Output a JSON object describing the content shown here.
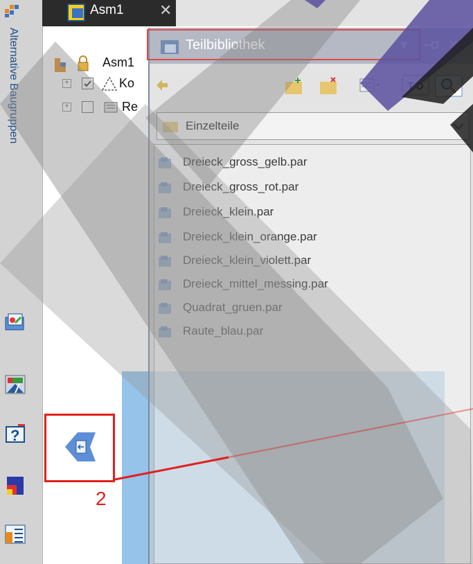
{
  "document_tab": {
    "label": "Asm1",
    "close_glyph": "✕"
  },
  "left_strip": {
    "vertical_tab_label": "Alternative Baugruppen",
    "icons": [
      "camera-view-icon",
      "color-gauge-icon",
      "help-query-icon",
      "heatmap-icon",
      "list-view-icon"
    ]
  },
  "tree": {
    "root_label": "Asm1",
    "child_1_label": "Ko",
    "child_2_label": "Re",
    "expand_glyph": "+"
  },
  "library": {
    "title": "Teilbibliothek",
    "title_buttons": [
      "▾",
      "✕"
    ],
    "folder_label": "Einzelteile",
    "files": [
      "Dreieck_gross_gelb.par",
      "Dreieck_gross_rot.par",
      "Dreieck_klein.par",
      "Dreieck_klein_orange.par",
      "Dreieck_klein_violett.par",
      "Dreieck_mittel_messing.par",
      "Quadrat_gruen.par",
      "Raute_blau.par"
    ]
  },
  "annotation": {
    "number": "2"
  },
  "colors": {
    "annotation_red": "#e0201c",
    "panel_blue": "#95c3ea",
    "text_blue": "#1c4f8a",
    "icon_blue": "#5c8fd6"
  }
}
